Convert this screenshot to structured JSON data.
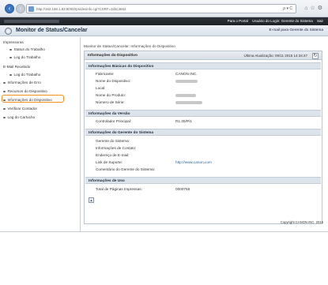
{
  "browser": {
    "address": "http://192.168.1.83:8000/rps/devinfo.cgi?CSRF=2d2c3652",
    "address_tools": "ρ ▾ C"
  },
  "topbar": {
    "portal_link": "Para o Portal",
    "login_user": "Usuário do Login: Gerente do Sistema",
    "logout": "Sair"
  },
  "subbar": {
    "title": "Monitor de Status/Cancelar",
    "right_link": "E-mail para Gerente do Sistema"
  },
  "sidebar": {
    "group_print": "Impressoras",
    "status_job": "Status do Trabalho",
    "job_log": "Log do Trabalho",
    "group_email": "E-Mail Recebido",
    "email_job_log": "Log do Trabalho",
    "error_info": "Informações de Erro",
    "consumables": "Recursos do Dispositivo",
    "device_info": "Informações do Dispositivo",
    "check_counter": "Verificar Contador",
    "cartridge_log": "Log do Cartucho"
  },
  "main": {
    "breadcrumb": "Monitor de Status/Cancelar: Informações do Dispositivo",
    "panel_title": "Informações do Dispositivo",
    "last_update": "Última Atualização: 09/11 2015 14:34:47",
    "basic_title": "Informações Básicas do Dispositivo",
    "manufacturer_label": "Fabricante:",
    "manufacturer_value": "CANON INC.",
    "device_name_label": "Nome do Dispositivo:",
    "location_label": "Local:",
    "product_name_label": "Nome do Produto:",
    "serial_label": "Número de Série:",
    "version_title": "Informações da Versão",
    "controller_label": "Controlador Principal:",
    "controller_value": "R1.30/P/1",
    "manager_title": "Informações do Gerente do Sistema",
    "sys_manager_label": "Gerente do Sistema:",
    "contact_label": "Informações de Contato:",
    "email_label": "Endereço de E-mail:",
    "support_label": "Link de Suporte:",
    "support_value": "http://www.canon.com",
    "comment_label": "Comentário do Gerente do Sistema:",
    "usage_title": "Informações de Uso",
    "total_prints_label": "Total de Páginas Impressas:",
    "total_prints_value": "0000755"
  },
  "footer": {
    "copyright": "Copyright CANON INC. 2016"
  },
  "colors": {
    "accent": "#f0921e",
    "header_dark": "#24292e",
    "link": "#2a62a8"
  }
}
